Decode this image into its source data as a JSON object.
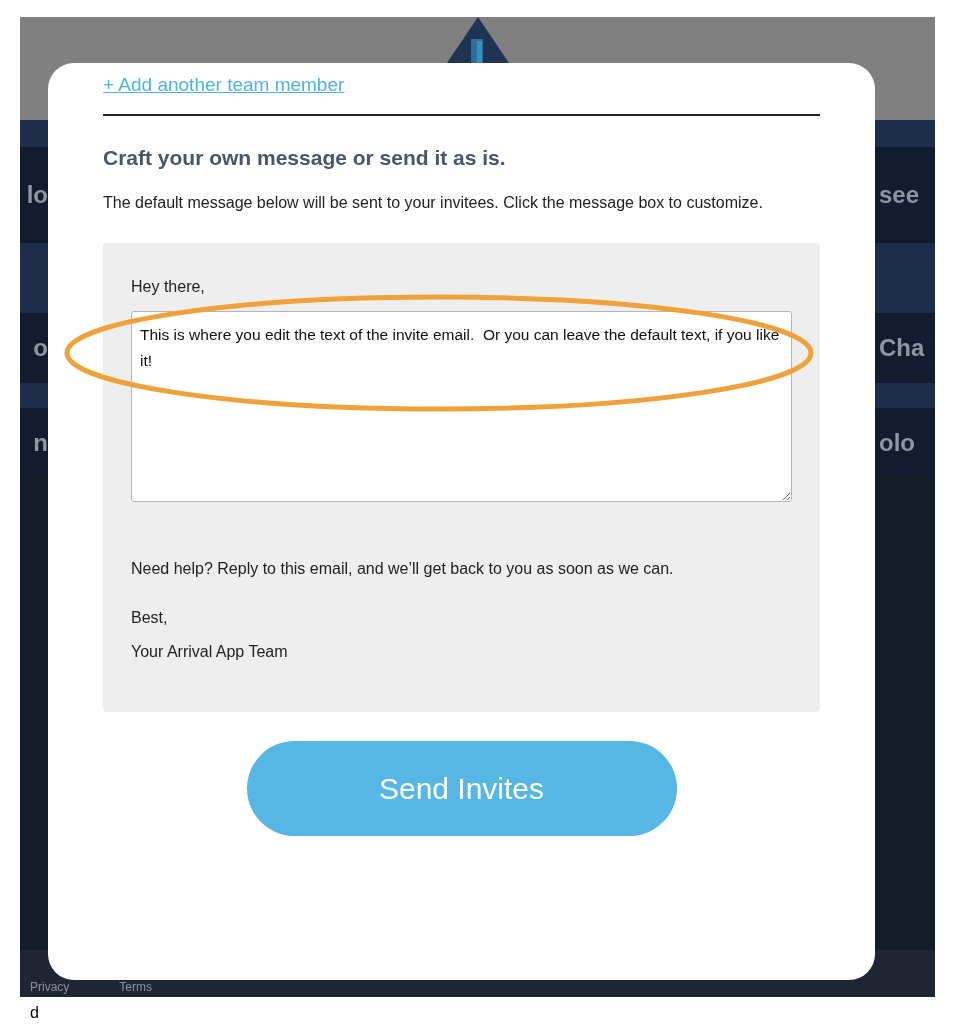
{
  "background": {
    "rows": [
      {
        "left": "lo",
        "right": "see"
      },
      {
        "left": "o",
        "right": "Cha"
      },
      {
        "left": "n",
        "right": "olo"
      }
    ],
    "footer_links": [
      "Privacy",
      "Terms"
    ]
  },
  "modal": {
    "add_link": "+ Add another team member",
    "heading": "Craft your own message or send it as is.",
    "intro": "The default message below will be sent to your invitees. Click the message box to customize.",
    "message": {
      "greeting": "Hey there,",
      "editable_text": "This is where you edit the text of the invite email.  Or you can leave the default text, if you like it!",
      "help": "Need help?  Reply to this email, and we’ll get back to you as soon as we can.",
      "signoff": "Best,",
      "signature": "Your Arrival App Team"
    },
    "send_button": "Send Invites"
  },
  "caption": "d"
}
